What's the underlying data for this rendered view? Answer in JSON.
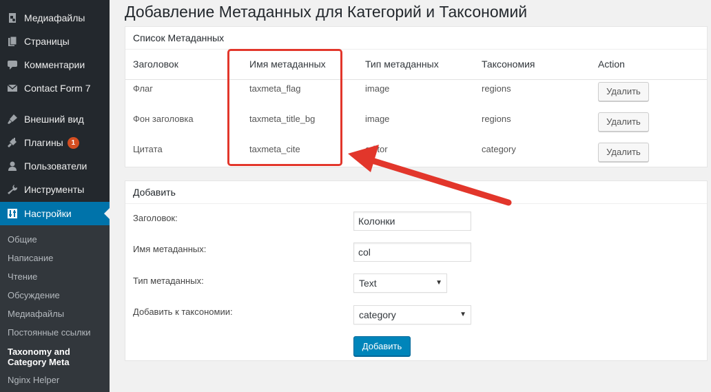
{
  "sidebar": {
    "items": [
      {
        "label": "Медиафайлы",
        "icon": "media-icon"
      },
      {
        "label": "Страницы",
        "icon": "pages-icon"
      },
      {
        "label": "Комментарии",
        "icon": "comments-icon"
      },
      {
        "label": "Contact Form 7",
        "icon": "mail-icon"
      },
      {
        "label": "Внешний вид",
        "icon": "appearance-icon"
      },
      {
        "label": "Плагины",
        "icon": "plugins-icon",
        "badge": "1"
      },
      {
        "label": "Пользователи",
        "icon": "users-icon"
      },
      {
        "label": "Инструменты",
        "icon": "tools-icon"
      },
      {
        "label": "Настройки",
        "icon": "settings-icon",
        "active": true
      }
    ],
    "submenu": [
      "Общие",
      "Написание",
      "Чтение",
      "Обсуждение",
      "Медиафайлы",
      "Постоянные ссылки",
      "Taxonomy and",
      "Category Meta",
      "Nginx Helper"
    ]
  },
  "page": {
    "title": "Добавление Метаданных для Категорий и Таксономий"
  },
  "list_panel": {
    "heading": "Список Метаданных",
    "columns": [
      "Заголовок",
      "Имя метаданных",
      "Тип метаданных",
      "Таксономия",
      "Action"
    ],
    "rows": [
      {
        "title": "Флаг",
        "name": "taxmeta_flag",
        "type": "image",
        "taxonomy": "regions",
        "action": "Удалить"
      },
      {
        "title": "Фон заголовка",
        "name": "taxmeta_title_bg",
        "type": "image",
        "taxonomy": "regions",
        "action": "Удалить"
      },
      {
        "title": "Цитата",
        "name": "taxmeta_cite",
        "type": "editor",
        "taxonomy": "category",
        "action": "Удалить"
      }
    ]
  },
  "add_panel": {
    "heading": "Добавить",
    "fields": {
      "title_label": "Заголовок:",
      "title_value": "Колонки",
      "name_label": "Имя метаданных:",
      "name_value": "col",
      "type_label": "Тип метаданных:",
      "type_value": "Text",
      "taxonomy_label": "Добавить к таксономии:",
      "taxonomy_value": "category"
    },
    "submit_label": "Добавить"
  },
  "colors": {
    "sidebar_bg": "#23282d",
    "active_bg": "#0073aa",
    "primary_button": "#0085ba",
    "annotation_red": "#e2362b"
  }
}
